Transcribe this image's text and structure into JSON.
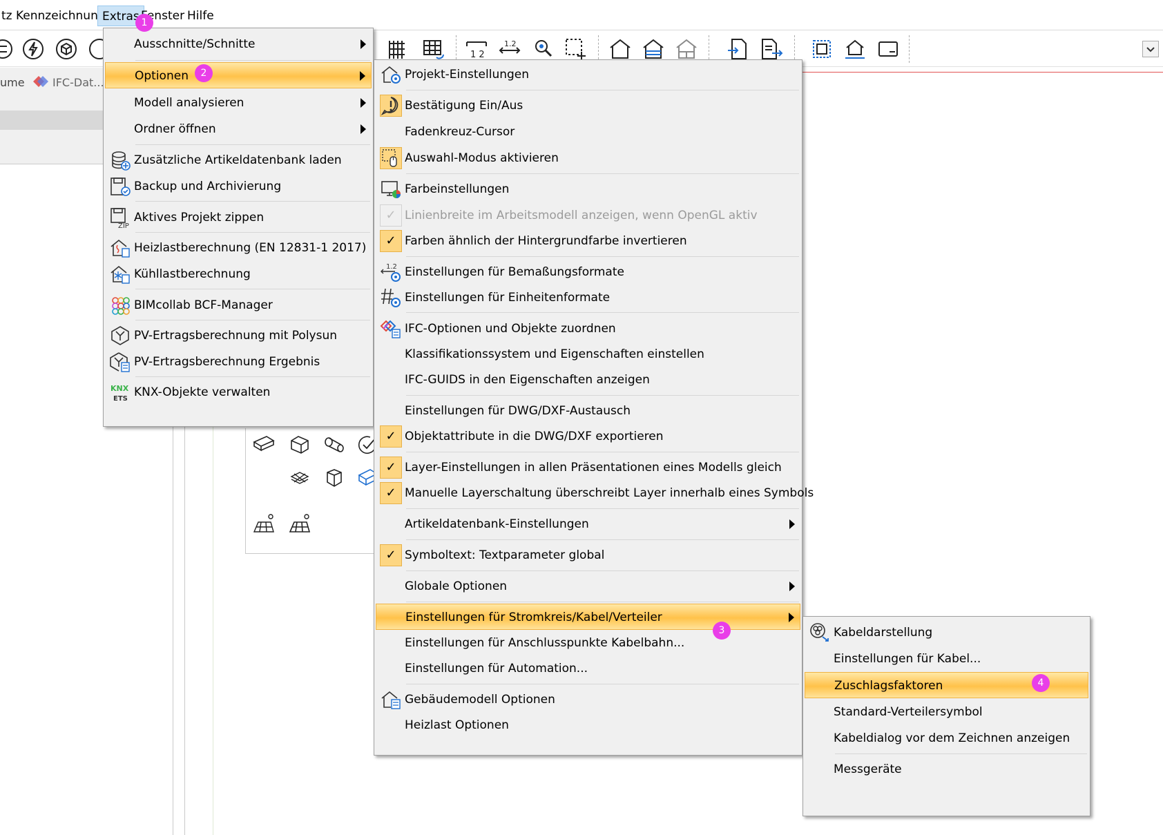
{
  "menubar": {
    "items": [
      {
        "label": "tz"
      },
      {
        "label": "Kennzeichnung"
      },
      {
        "label": "Extras"
      },
      {
        "label": "Fenster"
      },
      {
        "label": "Hilfe"
      }
    ]
  },
  "left_tabs": {
    "tab1": "ume",
    "tab2": "IFC-Dat..."
  },
  "extras_menu": {
    "items": [
      {
        "label": "Ausschnitte/Schnitte",
        "submenu": true
      },
      {
        "label": "Optionen",
        "submenu": true,
        "highlighted": true
      },
      {
        "label": "Modell analysieren",
        "submenu": true
      },
      {
        "label": "Ordner öffnen",
        "submenu": true
      },
      {
        "label": "Zusätzliche Artikeldatenbank laden",
        "icon": "database-add-icon"
      },
      {
        "label": "Backup und Archivierung",
        "icon": "backup-icon"
      },
      {
        "label": "Aktives Projekt zippen",
        "icon": "zip-icon"
      },
      {
        "label": "Heizlastberechnung (EN 12831-1 2017)",
        "icon": "heating-load-icon"
      },
      {
        "label": "Kühllastberechnung",
        "icon": "cooling-load-icon"
      },
      {
        "label": "BIMcollab BCF-Manager",
        "icon": "bimcollab-icon"
      },
      {
        "label": "PV-Ertragsberechnung mit Polysun",
        "icon": "polysun-icon"
      },
      {
        "label": "PV-Ertragsberechnung Ergebnis",
        "icon": "polysun-result-icon"
      },
      {
        "label": "KNX-Objekte verwalten",
        "icon": "knx-ets-icon"
      }
    ]
  },
  "options_menu": {
    "items": [
      {
        "label": "Projekt-Einstellungen",
        "icon": "project-settings-icon"
      },
      {
        "label": "Bestätigung Ein/Aus",
        "icon": "confirmation-icon",
        "checked": true
      },
      {
        "label": "Fadenkreuz-Cursor"
      },
      {
        "label": "Auswahl-Modus aktivieren",
        "icon": "selection-mode-icon",
        "checked": true
      },
      {
        "label": "Farbeinstellungen",
        "icon": "color-settings-icon"
      },
      {
        "label": "Linienbreite im Arbeitsmodell anzeigen, wenn OpenGL aktiv",
        "checked": true,
        "disabled": true
      },
      {
        "label": "Farben ähnlich der Hintergrundfarbe invertieren",
        "checked": true
      },
      {
        "label": "Einstellungen für Bemaßungsformate",
        "icon": "dimension-format-icon"
      },
      {
        "label": "Einstellungen für Einheitenformate",
        "icon": "unit-format-icon"
      },
      {
        "label": "IFC-Optionen und Objekte zuordnen",
        "icon": "ifc-options-icon"
      },
      {
        "label": "Klassifikationssystem und Eigenschaften einstellen"
      },
      {
        "label": "IFC-GUIDS in den Eigenschaften anzeigen"
      },
      {
        "label": "Einstellungen für DWG/DXF-Austausch"
      },
      {
        "label": "Objektattribute in die DWG/DXF exportieren",
        "checked": true
      },
      {
        "label": "Layer-Einstellungen in allen Präsentationen eines Modells gleich",
        "checked": true
      },
      {
        "label": "Manuelle Layerschaltung überschreibt Layer innerhalb eines Symbols",
        "checked": true
      },
      {
        "label": "Artikeldatenbank-Einstellungen",
        "submenu": true
      },
      {
        "label": "Symboltext: Textparameter global",
        "checked": true
      },
      {
        "label": "Globale Optionen",
        "submenu": true
      },
      {
        "label": "Einstellungen für Stromkreis/Kabel/Verteiler",
        "submenu": true,
        "highlighted": true
      },
      {
        "label": "Einstellungen für Anschlusspunkte Kabelbahn..."
      },
      {
        "label": "Einstellungen für Automation..."
      },
      {
        "label": "Gebäudemodell Optionen",
        "icon": "building-model-icon"
      },
      {
        "label": "Heizlast Optionen"
      }
    ]
  },
  "circuit_menu": {
    "items": [
      {
        "label": "Kabeldarstellung",
        "icon": "cable-display-icon"
      },
      {
        "label": "Einstellungen für Kabel..."
      },
      {
        "label": "Zuschlagsfaktoren",
        "highlighted": true
      },
      {
        "label": "Standard-Verteilersymbol"
      },
      {
        "label": "Kabeldialog vor dem Zeichnen anzeigen"
      },
      {
        "label": "Messgeräte"
      }
    ]
  },
  "badges": [
    "1",
    "2",
    "3",
    "4"
  ],
  "colors": {
    "highlight": "#ffc24a",
    "check_bg": "#fdd682",
    "badge": "#e93ee8",
    "menubar_active": "#cce4f7",
    "accent_line": "#e25353"
  }
}
